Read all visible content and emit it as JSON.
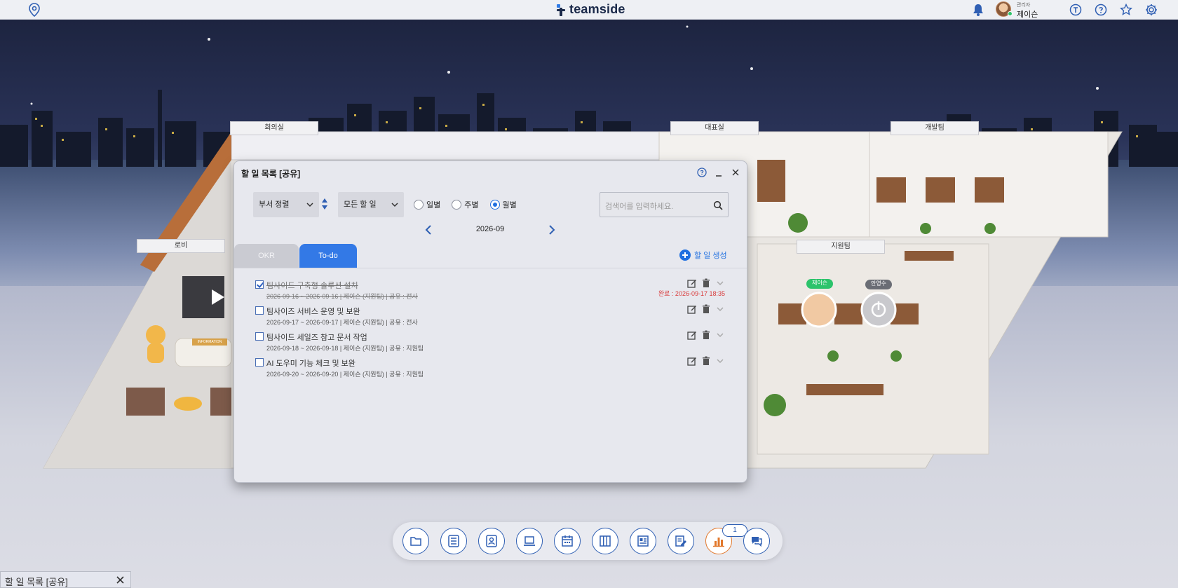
{
  "app": {
    "brand": "teamside",
    "user": {
      "role": "관리자",
      "name": "제이슨",
      "status_color": "#2cc36b"
    }
  },
  "topbar": {
    "icons": [
      "location-pin-icon",
      "bell-icon",
      "t-icon",
      "help-icon",
      "star-icon",
      "gear-icon"
    ]
  },
  "rooms": {
    "meeting": "회의실",
    "ceo": "대표실",
    "dev": "개발팀",
    "lobby": "로비",
    "support": "지원팀",
    "reception_sign": "INFORMATION"
  },
  "avatars": {
    "jason": "제이슨",
    "other": "안영수"
  },
  "dialog": {
    "title": "할 일 목록 [공유]",
    "sort_select": "부서 정렬",
    "filter_select": "모든 할 일",
    "radios": [
      {
        "label": "일별",
        "checked": false
      },
      {
        "label": "주별",
        "checked": false
      },
      {
        "label": "월별",
        "checked": true
      }
    ],
    "month": "2026-09",
    "search_placeholder": "검색어를 입력하세요.",
    "tabs": {
      "okr": "OKR",
      "todo": "To-do",
      "active": "To-do"
    },
    "create_label": "할 일 생성",
    "tasks": [
      {
        "title": "팀사이드 구축형 솔루션 설치",
        "meta": "2026-09-16 ~ 2026-09-16  |  제이슨 (지원팀)  |  공유 : 전사",
        "done": true,
        "done_time": "완료 : 2026-09-17 18:35"
      },
      {
        "title": "팀사이즈 서비스 운영 및 보완",
        "meta": "2026-09-17 ~ 2026-09-17  |  제이슨 (지원팀)  |  공유 : 전사",
        "done": false,
        "done_time": ""
      },
      {
        "title": "팀사이드 세일즈 참고 문서 작업",
        "meta": "2026-09-18 ~ 2026-09-18  |  제이슨 (지원팀)  |  공유 : 지원팀",
        "done": false,
        "done_time": ""
      },
      {
        "title": "AI 도우미 기능 체크 및 보완",
        "meta": "2026-09-20 ~ 2026-09-20  |  제이슨 (지원팀)  |  공유 : 지원팀",
        "done": false,
        "done_time": ""
      }
    ]
  },
  "dock": {
    "items": [
      "folder-icon",
      "list-icon",
      "contacts-icon",
      "laptop-icon",
      "calendar-icon",
      "kanban-icon",
      "news-icon",
      "note-edit-icon",
      "chart-icon",
      "chat-icon"
    ],
    "active": "chart-icon",
    "badge": "1"
  },
  "minibar": {
    "label": "할 일 목록 [공유]"
  },
  "colors": {
    "accent": "#3379e6",
    "brand_navy": "#1b2a4a",
    "done_red": "#d83a3a"
  }
}
